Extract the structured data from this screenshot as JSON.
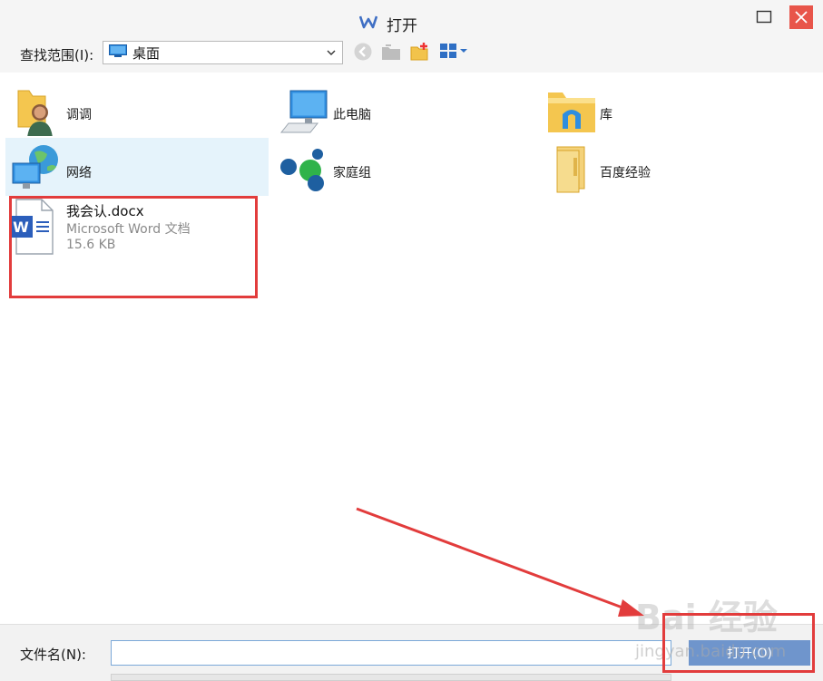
{
  "window": {
    "title": "打开",
    "app_icon": "wps-writer-icon",
    "maximize_icon": "maximize-icon",
    "close_icon": "close-icon"
  },
  "toolbar": {
    "look_in_label": "查找范围(I):",
    "look_in_value": "桌面",
    "icons": [
      "back-icon",
      "up-folder-icon",
      "new-folder-icon",
      "view-menu-icon"
    ]
  },
  "items": [
    {
      "label": "调调",
      "icon": "user-folder-icon"
    },
    {
      "label": "此电脑",
      "icon": "computer-icon"
    },
    {
      "label": "库",
      "icon": "library-icon"
    },
    {
      "label": "网络",
      "icon": "network-icon",
      "selected": true
    },
    {
      "label": "家庭组",
      "icon": "homegroup-icon"
    },
    {
      "label": "百度经验",
      "icon": "folder-icon"
    }
  ],
  "file": {
    "name": "我会认.docx",
    "type": "Microsoft Word 文档",
    "size": "15.6 KB",
    "icon": "word-document-icon"
  },
  "bottom": {
    "filename_label": "文件名(N):",
    "filename_value": "",
    "open_button": "打开(O)"
  },
  "watermark": {
    "main": "Bai 经验",
    "sub": "jingyan.baidu.com"
  },
  "colors": {
    "annotation": "#e23c3c",
    "selected_bg": "#e5f3fb",
    "open_button": "#6f95cc",
    "close_button": "#e8554a"
  }
}
